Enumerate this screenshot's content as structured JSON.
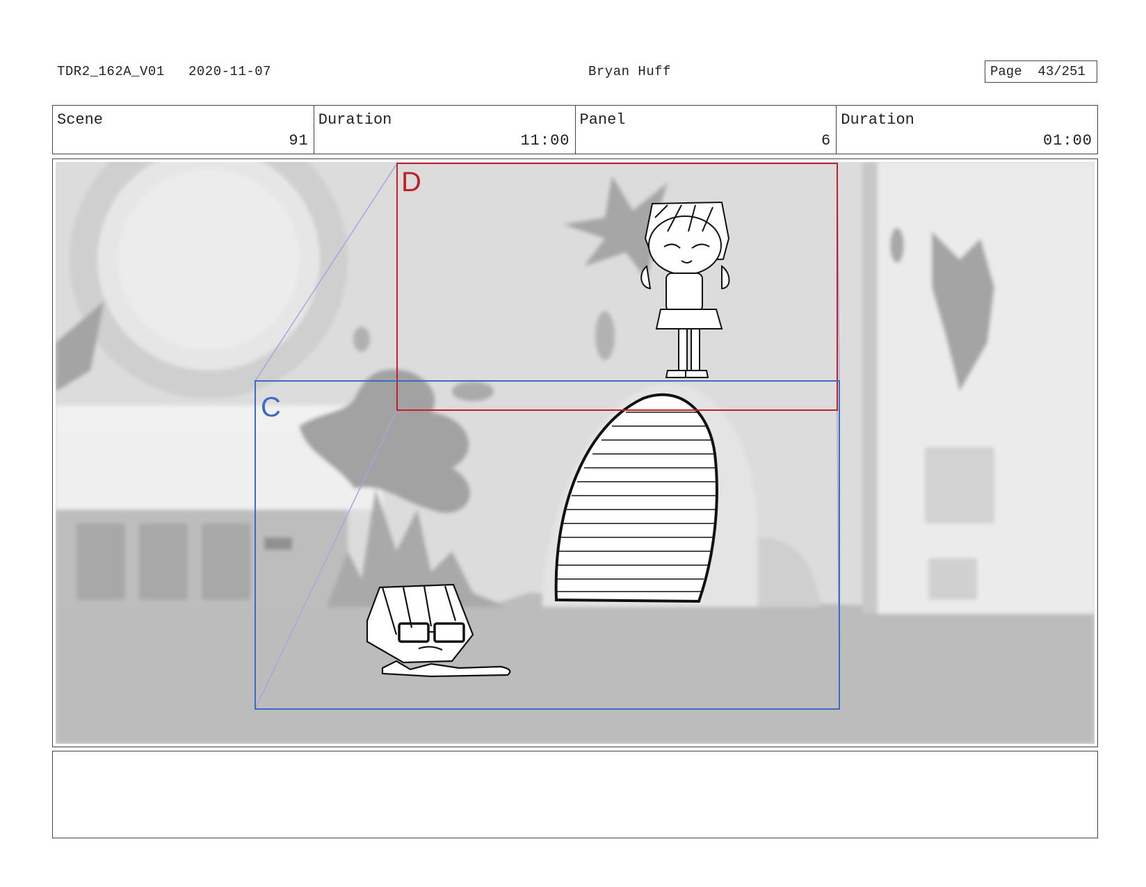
{
  "header": {
    "doc_id": "TDR2_162A_V01",
    "date": "2020-11-07",
    "author": "Bryan Huff",
    "page_label": "Page",
    "page_value": "43/251"
  },
  "info": {
    "scene_label": "Scene",
    "scene_value": "91",
    "scene_duration_label": "Duration",
    "scene_duration_value": "11:00",
    "panel_label": "Panel",
    "panel_value": "6",
    "panel_duration_label": "Duration",
    "panel_duration_value": "01:00"
  },
  "panel": {
    "frame_d_label": "D",
    "frame_c_label": "C",
    "frame_d_color": "#c0202a",
    "frame_c_color": "#3a6cc6",
    "tween_line_color": "#a6a6dc"
  },
  "notes": {
    "text": ""
  }
}
